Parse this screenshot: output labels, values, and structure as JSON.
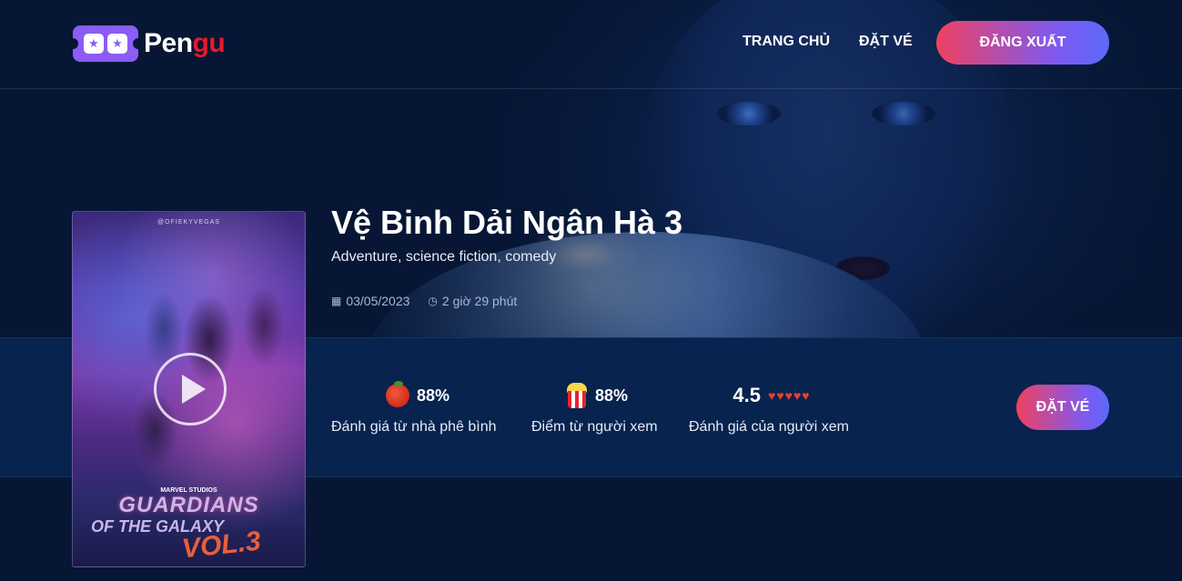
{
  "header": {
    "brand_main": "Pen",
    "brand_accent": "gu",
    "nav": [
      {
        "label": "TRANG CHỦ"
      },
      {
        "label": "ĐẶT VÉ"
      }
    ],
    "logout_label": "ĐĂNG XUẤT"
  },
  "movie": {
    "title": "Vệ Binh Dải Ngân Hà 3",
    "genres": "Adventure, science fiction, comedy",
    "release_date": "03/05/2023",
    "duration": "2 giờ 29 phút",
    "poster": {
      "credit": "@OFIEKYVEGAS",
      "studio": "MARVEL STUDIOS",
      "title_line1": "GUARDIANS",
      "title_line2": "OF THE GALAXY",
      "vol": "VOL.3"
    }
  },
  "stats": {
    "critics": {
      "value": "88%",
      "label": "Đánh giá từ nhà phê bình",
      "icon": "tomato-icon"
    },
    "audience": {
      "value": "88%",
      "label": "Điểm từ người xem",
      "icon": "popcorn-icon"
    },
    "rating": {
      "value": "4.5",
      "hearts": "♥♥♥♥♥",
      "label": "Đánh giá của người xem",
      "stars": 4.5
    }
  },
  "book_button_label": "ĐẶT VÉ",
  "colors": {
    "background": "#061634",
    "band": "#07234e",
    "gradient_start": "#ef4160",
    "gradient_end": "#5b6af8",
    "brand_accent": "#e61a2c",
    "heart": "#e8402f"
  }
}
